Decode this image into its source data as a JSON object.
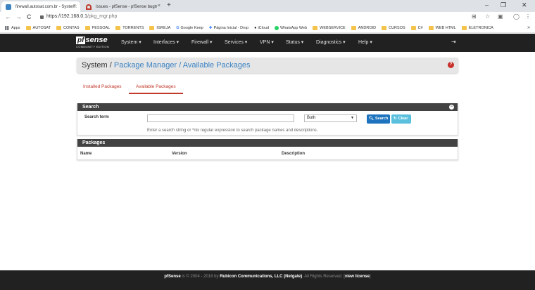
{
  "browser": {
    "tabs": [
      {
        "title": "firewall.autosat.com.br - System:",
        "close": "×"
      },
      {
        "title": "Issues - pfSense - pfSense bugtr",
        "close": "×"
      }
    ],
    "new_tab": "+",
    "window_controls": {
      "minimize": "–",
      "restore": "❐",
      "close": "✕"
    },
    "nav": {
      "back": "←",
      "forward": "→",
      "reload": "C"
    },
    "url_host": "https://192.168.0.1",
    "url_path": "/pkg_mgr.php",
    "bookmarks": [
      "Apps",
      "AUTOSAT",
      "CONTAS",
      "PESSOAL",
      "TORRENTS",
      "IGREJA",
      "Google Keep",
      "Página Inicial - Drop",
      "iCloud",
      "WhatsApp Web",
      "WEBSERVICE",
      "ANDROID",
      "CURSOS",
      "C#",
      "WEB HTML",
      "ELETRONICA"
    ],
    "bookmarks_more": "»"
  },
  "navbar": {
    "logo_pf": "pf",
    "logo_sense": "sense",
    "logo_edition": "COMMUNITY EDITION",
    "menu": [
      "System ▾",
      "Interfaces ▾",
      "Firewall ▾",
      "Services ▾",
      "VPN ▾",
      "Status ▾",
      "Diagnostics ▾",
      "Help ▾"
    ]
  },
  "breadcrumb": {
    "root": "System /",
    "mid": "Package Manager /",
    "current": "Available Packages",
    "help": "?"
  },
  "tabs": {
    "installed": "Installed Packages",
    "available": "Available Packages"
  },
  "search": {
    "heading": "Search",
    "collapse": "−",
    "label": "Search term",
    "value": "",
    "select_value": "Both",
    "search_button": "Search",
    "clear_button": "Clear",
    "hint": "Enter a search string or *nix regular expression to search package names and descriptions."
  },
  "packages": {
    "heading": "Packages",
    "columns": [
      "Name",
      "Version",
      "Description"
    ]
  },
  "footer": {
    "brand": "pfSense",
    "text1": " is © 2004 - 2018 by ",
    "company": "Rubicon Communications, LLC (Netgate)",
    "text2": ". All Rights Reserved. [",
    "license": "view license",
    "text3": "]"
  },
  "colors": {
    "navbar": "#212121",
    "link": "#3c83c3",
    "tab_active": "#c0392b",
    "search_btn": "#1e73be",
    "clear_btn": "#5bc0de"
  }
}
